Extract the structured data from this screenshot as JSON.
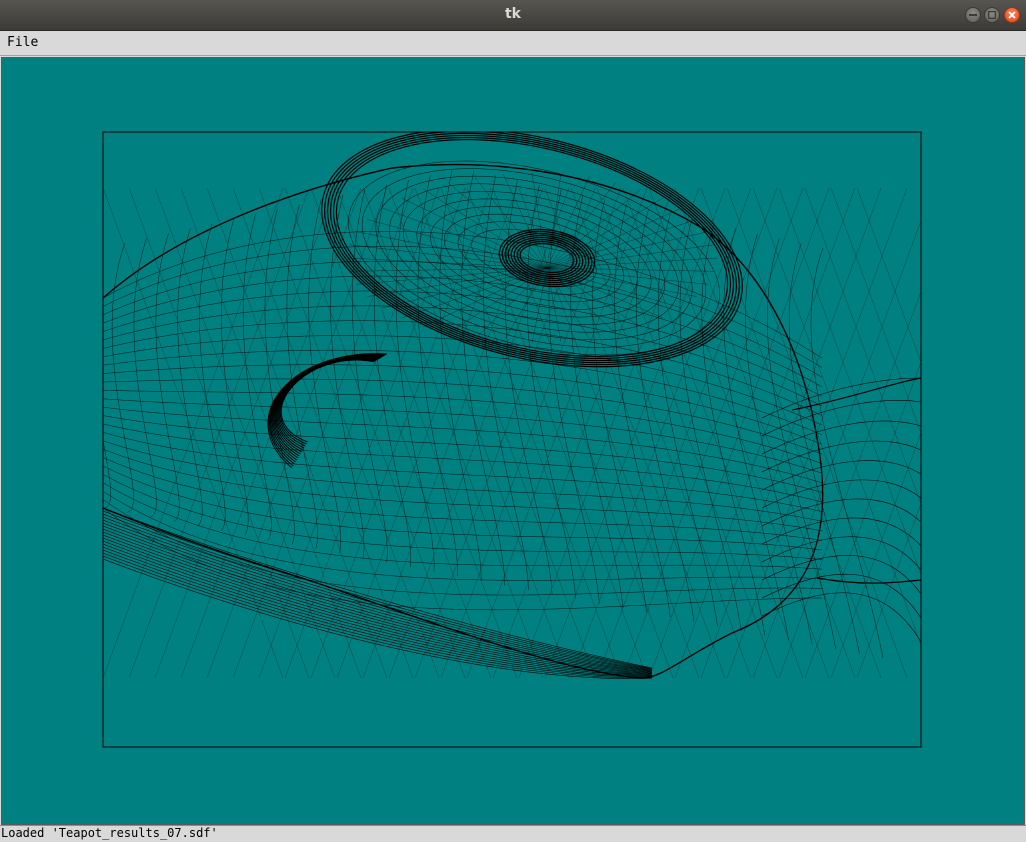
{
  "window": {
    "title": "tk"
  },
  "menubar": {
    "file_label": "File"
  },
  "canvas": {
    "background_color": "#008080",
    "wire_color": "#000000",
    "model": "teapot-wireframe"
  },
  "status": {
    "text": "Loaded 'Teapot_results_07.sdf'"
  }
}
